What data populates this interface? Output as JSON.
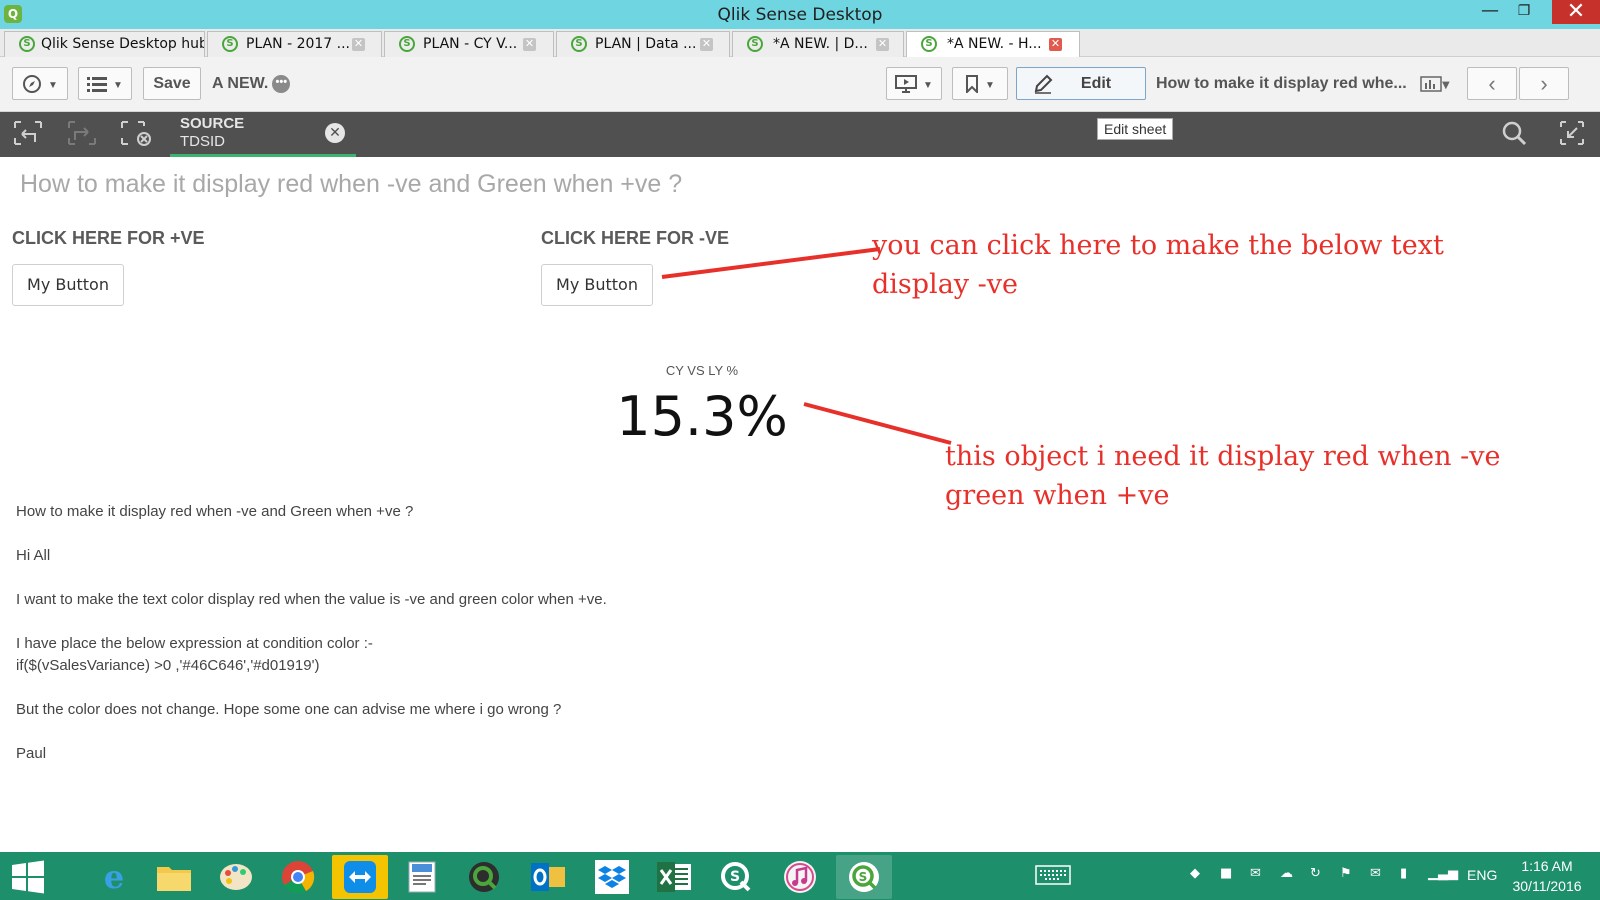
{
  "window": {
    "title": "Qlik Sense Desktop",
    "minimize": "—",
    "maximize": "❐",
    "close": "✕"
  },
  "tabs": [
    {
      "label": "Qlik Sense Desktop hub",
      "closable": false
    },
    {
      "label": "PLAN - 2017 ...",
      "closable": true
    },
    {
      "label": "PLAN - CY V...",
      "closable": true
    },
    {
      "label": "PLAN | Data ...",
      "closable": true
    },
    {
      "label": "*A NEW. | D...",
      "closable": true
    },
    {
      "label": "*A NEW. - H...",
      "closable": true,
      "active": true
    }
  ],
  "toolbar": {
    "save_label": "Save",
    "app_name": "A NEW.",
    "app_menu_glyph": "•••",
    "edit_label": "Edit",
    "sheet_title": "How to make it display red whe...",
    "icons": [
      "compass-icon",
      "list-icon",
      "present-icon",
      "bookmark-icon",
      "pencil-icon",
      "chart-icon",
      "chevron-left-icon",
      "chevron-right-icon"
    ]
  },
  "selections": {
    "field_name": "SOURCE",
    "field_value": "TDSID",
    "clear_glyph": "✕",
    "tooltip": "Edit sheet"
  },
  "sheet": {
    "heading": "How to make it display red when -ve and Green when +ve ?",
    "button_left_label": "CLICK HERE FOR +VE",
    "button_left_text": "My Button",
    "button_right_label": "CLICK HERE FOR -VE",
    "button_right_text": "My Button",
    "kpi": {
      "label": "CY VS LY %",
      "value": "15.3%"
    },
    "text_lines": [
      "How to make it display red when -ve and Green when +ve ?",
      "Hi All",
      "I want to make the text color display red when the value is -ve and green color when +ve.",
      "I have place the below expression at condition color :-",
      "if($(vSalesVariance) >0 ,'#46C646','#d01919')",
      "But the color does not change. Hope some one can advise me where i go wrong ?",
      "Paul"
    ]
  },
  "annotations": {
    "button_note": [
      "you can click here to make the below text",
      "display -ve"
    ],
    "kpi_note": [
      "this object i need it display red when -ve",
      "green when +ve"
    ],
    "color": "#e8302a"
  },
  "taskbar": {
    "pins": [
      "ie-icon",
      "explorer-icon",
      "paint-icon",
      "chrome-icon",
      "teamviewer-icon",
      "wordpad-icon",
      "qlikview-icon",
      "outlook-icon",
      "dropbox-icon",
      "excel-icon",
      "qliksense-icon",
      "itunes-icon",
      "qliksense-active-icon"
    ],
    "lang": "ENG",
    "time": "1:16 AM",
    "date": "30/11/2016"
  }
}
